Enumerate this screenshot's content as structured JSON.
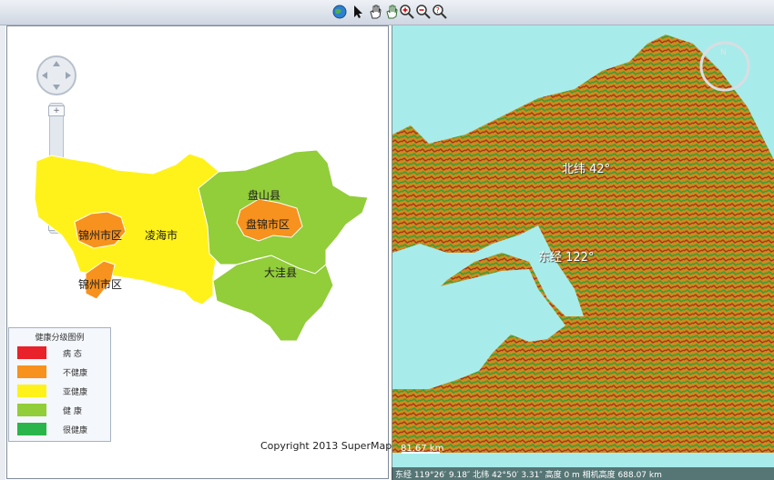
{
  "toolbar": {
    "icons": [
      "globe-icon",
      "arrow-pointer-icon",
      "pan-hand-icon",
      "hand-tool-icon",
      "zoom-in-icon",
      "zoom-out-icon",
      "help-zoom-icon"
    ]
  },
  "left_map": {
    "regions": [
      {
        "name": "锦州市区",
        "health": "不健康"
      },
      {
        "name": "凌海市",
        "health": "亚健康"
      },
      {
        "name": "锦州市区",
        "health": "不健康"
      },
      {
        "name": "盘山县",
        "health": "健康"
      },
      {
        "name": "盘锦市区",
        "health": "不健康"
      },
      {
        "name": "大洼县",
        "health": "健康"
      }
    ],
    "legend": {
      "title": "健康分级图例",
      "items": [
        {
          "label": "病  态",
          "color": "#e8212a"
        },
        {
          "label": "不健康",
          "color": "#f7921e"
        },
        {
          "label": "亚健康",
          "color": "#fff21a"
        },
        {
          "label": "健  康",
          "color": "#92cd3a"
        },
        {
          "label": "很健康",
          "color": "#2ab54a"
        }
      ]
    },
    "copyright": "Copyright 2013 SuperMap",
    "colors": {
      "subhealthy": "#fff21a",
      "healthy": "#92cd3a",
      "unhealthy": "#f7921e"
    }
  },
  "globe": {
    "lat_label": "北纬 42°",
    "lon_label": "东经 122°",
    "scale": "81.67 km",
    "status": "东经 119°26′ 9.18″   北纬 42°50′ 3.31″   高度 0 m   相机高度 688.07 km"
  }
}
